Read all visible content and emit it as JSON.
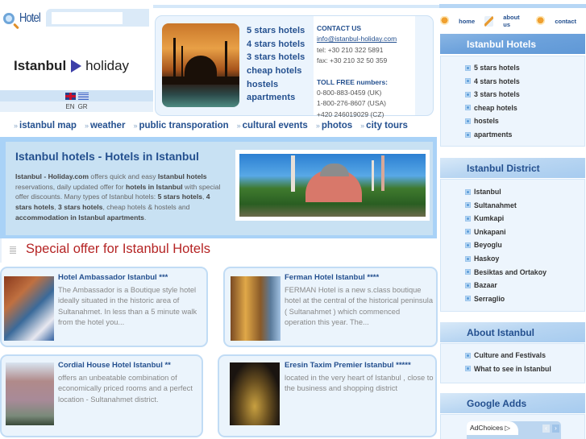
{
  "header": {
    "search_logo_label": "Hotel",
    "search_placeholder": "",
    "brand_part1": "Istanbul",
    "brand_part2": "holiday",
    "languages": [
      "EN",
      "GR"
    ]
  },
  "promo": {
    "links": [
      "5 stars hotels",
      "4 stars hotels",
      "3 stars hotels",
      "cheap hotels",
      "hostels",
      "apartments"
    ],
    "contact": {
      "title": "CONTACT US",
      "email": "info@istanbul-holiday.com",
      "tel": "tel: +30 210 322 5891",
      "fax": "fax: +30 210 32 50 359",
      "toll_free_title": "TOLL FREE numbers:",
      "toll_free": [
        "0-800-883-0459 (UK)",
        "1-800-276-8607 (USA)",
        "+420 246019029 (CZ)"
      ]
    }
  },
  "nav": {
    "links": [
      "istanbul map",
      "weather",
      "public transporation",
      "cultural events",
      "photos",
      "city tours"
    ]
  },
  "intro": {
    "title": "Istanbul hotels - Hotels in Istanbul",
    "text_parts": [
      {
        "b": true,
        "t": "Istanbul - Holiday.com"
      },
      {
        "b": false,
        "t": " offers quick and easy "
      },
      {
        "b": true,
        "t": "Istanbul hotels"
      },
      {
        "b": false,
        "t": " reservations, daily updated offer for "
      },
      {
        "b": true,
        "t": "hotels in Istanbul"
      },
      {
        "b": false,
        "t": " with special offer discounts. Many types of Istanbul hotels: "
      },
      {
        "b": true,
        "t": "5 stars hotels"
      },
      {
        "b": false,
        "t": ", "
      },
      {
        "b": true,
        "t": "4 stars hotels"
      },
      {
        "b": false,
        "t": ", "
      },
      {
        "b": true,
        "t": "3 stars hotels"
      },
      {
        "b": false,
        "t": ", cheap hotels & hostels and "
      },
      {
        "b": true,
        "t": "accommodation in Istanbul apartments"
      },
      {
        "b": false,
        "t": "."
      }
    ]
  },
  "special": {
    "title": "Special offer for Istanbul Hotels",
    "hotels": [
      {
        "name": "Hotel Ambassador Istanbul ***",
        "desc": "The Ambassador is a Boutique style hotel ideally situated in the historic area of Sultanahmet. In less than a 5 minute walk from the hotel you..."
      },
      {
        "name": "Ferman Hotel Istanbul ****",
        "desc": "FERMAN Hotel is a new s.class boutique hotel at the central of the historical peninsula ( Sultanahmet ) which commenced operation this year. The..."
      },
      {
        "name": "Cordial House Hotel Istanbul **",
        "desc": "offers an unbeatable combination of economically priced rooms and a perfect location - Sultanahmet district."
      },
      {
        "name": "Eresin Taxim Premier Istanbul *****",
        "desc": "located in the very heart of Istanbul , close to the business and shopping district"
      }
    ]
  },
  "sidebar": {
    "top_links": [
      "home",
      "about us",
      "contact"
    ],
    "sections": [
      {
        "title": "Istanbul Hotels",
        "items": [
          "5 stars hotels",
          "4 stars hotels",
          "3 stars hotels",
          "cheap hotels",
          "hostels",
          "apartments"
        ]
      },
      {
        "title": "Istanbul District",
        "items": [
          "Istanbul",
          "Sultanahmet",
          "Kumkapi",
          "Unkapani",
          "Beyoglu",
          "Haskoy",
          "Besiktas and Ortakoy",
          "Bazaar",
          "Serraglio"
        ]
      },
      {
        "title": "About Istanbul",
        "items": [
          "Culture and Festivals",
          "What to see in Istanbul"
        ]
      },
      {
        "title": "Google Adds",
        "items": []
      }
    ],
    "ad_label": "AdChoices ▷"
  },
  "colors": {
    "link_blue": "#24508f",
    "special_red": "#b52424",
    "panel_blue": "#c8e1f3"
  }
}
